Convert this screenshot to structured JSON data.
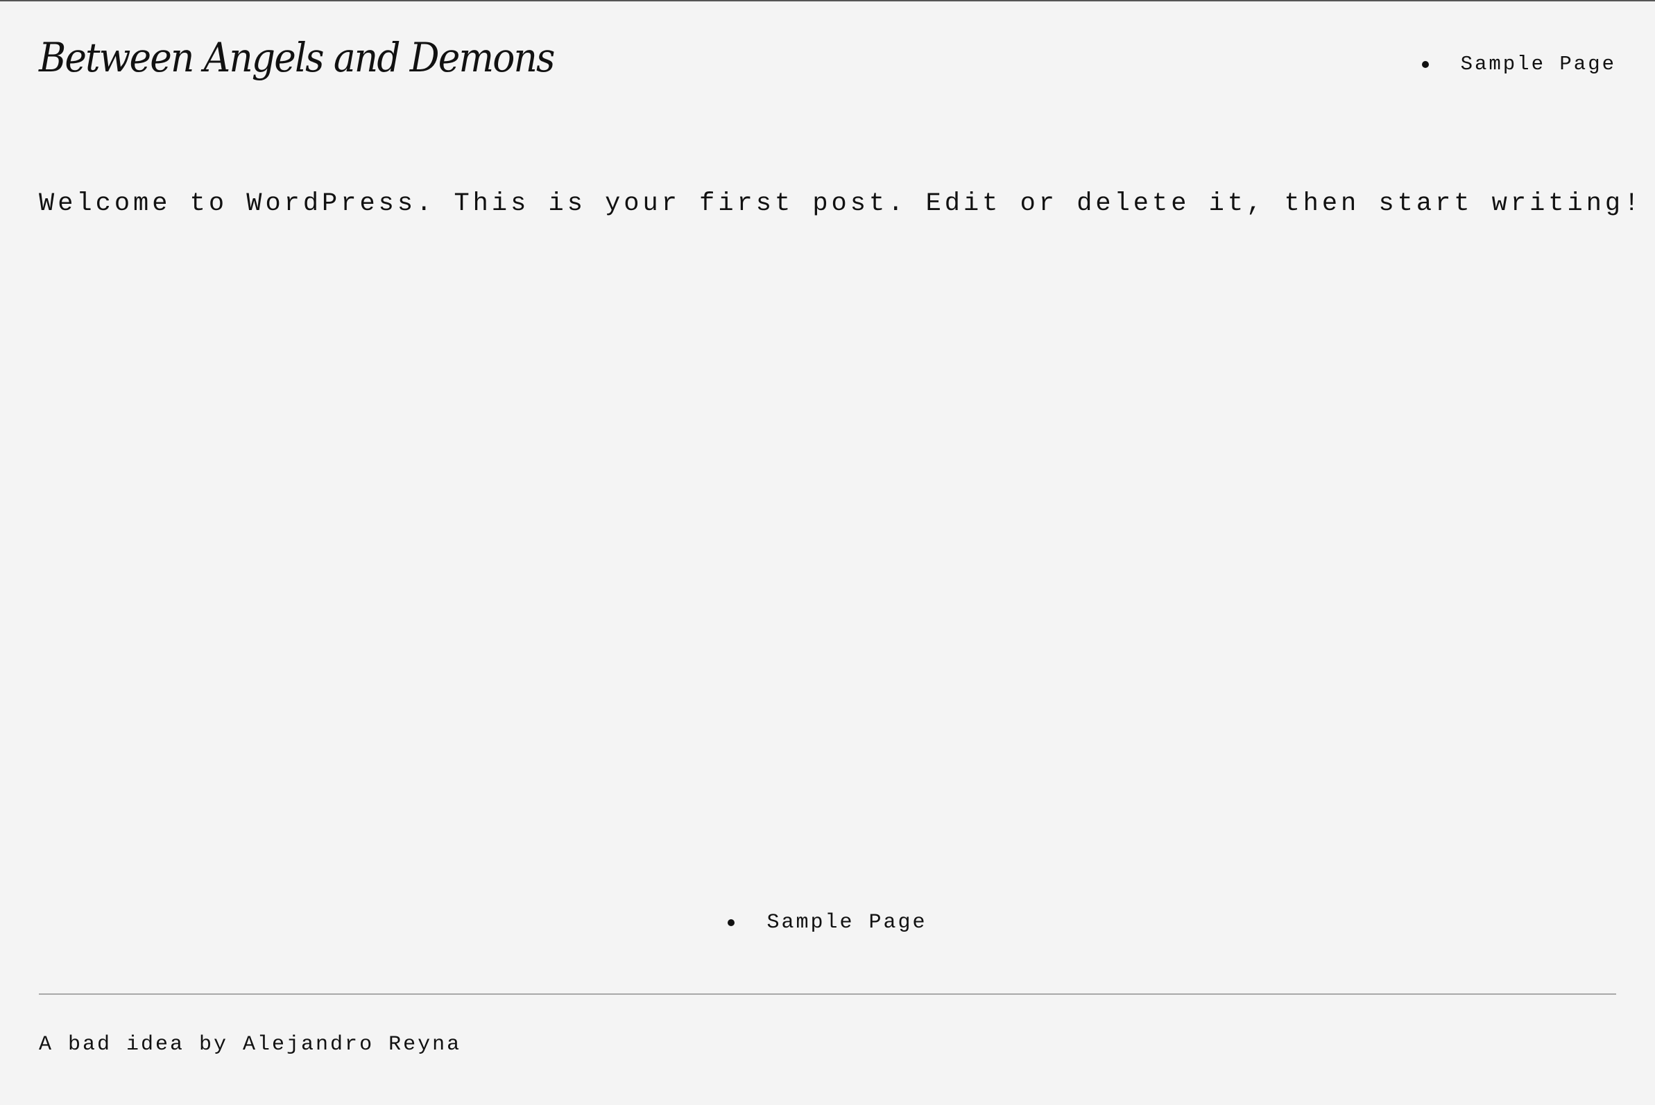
{
  "site": {
    "title": "Between Angels and Demons"
  },
  "header_nav": {
    "items": [
      {
        "label": "Sample Page"
      }
    ]
  },
  "post": {
    "content": "Welcome to WordPress. This is your first post. Edit or delete it, then start writing!"
  },
  "footer_nav": {
    "items": [
      {
        "label": "Sample Page"
      }
    ]
  },
  "footer": {
    "credit": "A bad idea by Alejandro Reyna"
  },
  "colors": {
    "background": "#f4f4f4",
    "text": "#111111",
    "rule": "#a8a8a8"
  }
}
